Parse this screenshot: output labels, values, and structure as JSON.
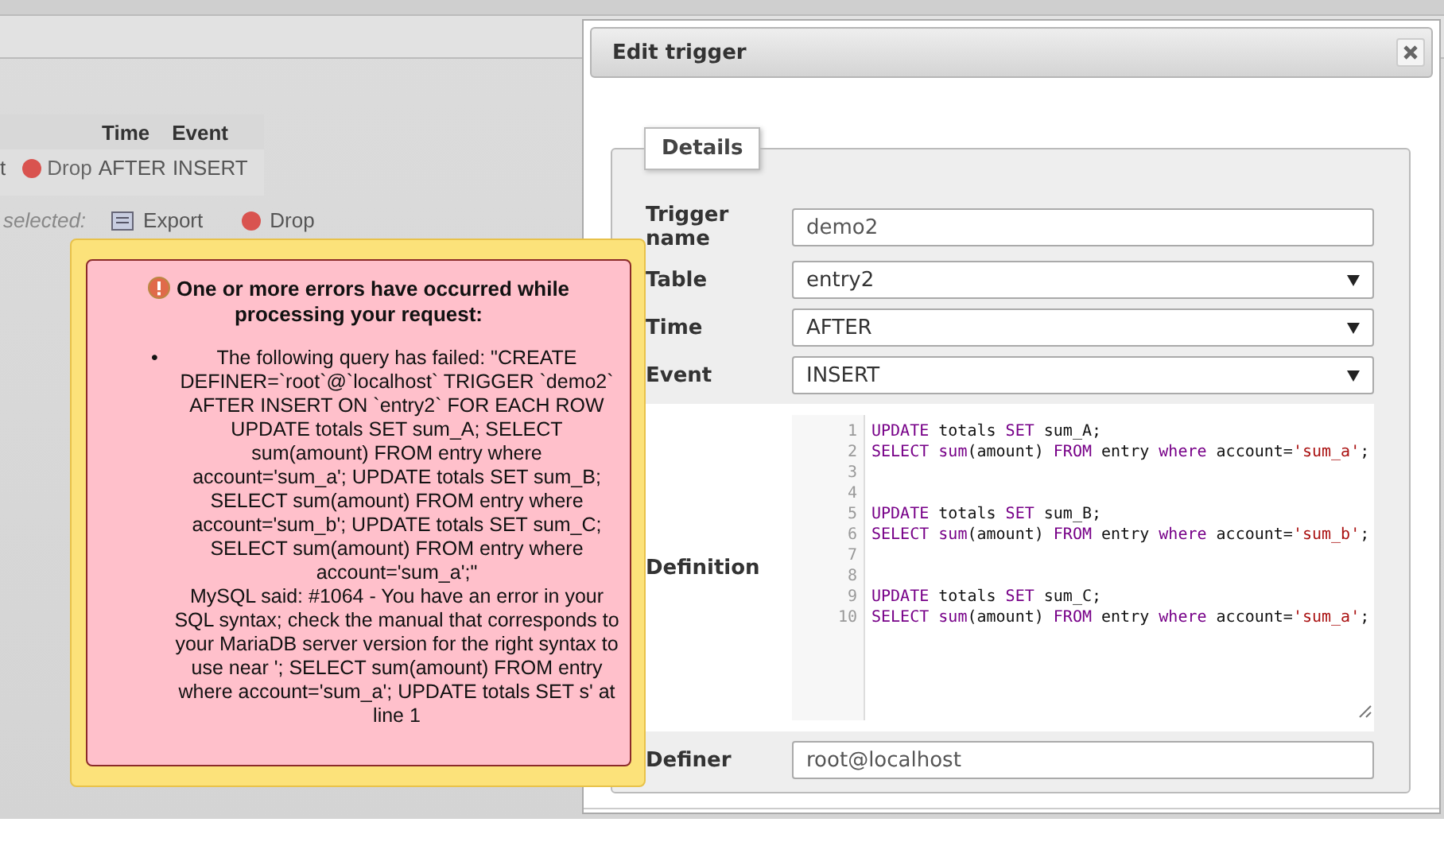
{
  "background_table": {
    "columns": [
      "Time",
      "Event"
    ],
    "row": {
      "action_fragment": "t",
      "drop_label": "Drop",
      "time": "AFTER",
      "event": "INSERT"
    },
    "selection_bar": {
      "label": "selected:",
      "actions": [
        "Export",
        "Drop"
      ]
    }
  },
  "dialog": {
    "title": "Edit trigger",
    "legend": "Details",
    "fields": [
      {
        "kind": "text",
        "label": "Trigger name",
        "value": "demo2"
      },
      {
        "kind": "select",
        "label": "Table",
        "value": "entry2"
      },
      {
        "kind": "select",
        "label": "Time",
        "value": "AFTER"
      },
      {
        "kind": "select",
        "label": "Event",
        "value": "INSERT"
      },
      {
        "kind": "code",
        "label": "Definition",
        "lines": [
          {
            "number": "1",
            "tokens": [
              {
                "kind": "keyword",
                "text": "UPDATE"
              },
              {
                "kind": "plain",
                "text": " totals "
              },
              {
                "kind": "keyword",
                "text": "SET"
              },
              {
                "kind": "plain",
                "text": " sum_A;"
              }
            ]
          },
          {
            "number": "2",
            "tokens": [
              {
                "kind": "keyword",
                "text": "SELECT "
              },
              {
                "kind": "keyword",
                "text": "sum"
              },
              {
                "kind": "plain",
                "text": "(amount) "
              },
              {
                "kind": "keyword",
                "text": "FROM"
              },
              {
                "kind": "plain",
                "text": " entry "
              },
              {
                "kind": "keyword",
                "text": "where"
              },
              {
                "kind": "plain",
                "text": " account="
              },
              {
                "kind": "string",
                "text": "'sum_a'"
              },
              {
                "kind": "plain",
                "text": ";"
              }
            ]
          },
          {
            "number": "3"
          },
          {
            "number": "4"
          },
          {
            "number": "5",
            "tokens": [
              {
                "kind": "keyword",
                "text": "UPDATE"
              },
              {
                "kind": "plain",
                "text": " totals "
              },
              {
                "kind": "keyword",
                "text": "SET"
              },
              {
                "kind": "plain",
                "text": " sum_B;"
              }
            ]
          },
          {
            "number": "6",
            "tokens": [
              {
                "kind": "keyword",
                "text": "SELECT "
              },
              {
                "kind": "keyword",
                "text": "sum"
              },
              {
                "kind": "plain",
                "text": "(amount) "
              },
              {
                "kind": "keyword",
                "text": "FROM"
              },
              {
                "kind": "plain",
                "text": " entry "
              },
              {
                "kind": "keyword",
                "text": "where"
              },
              {
                "kind": "plain",
                "text": " account="
              },
              {
                "kind": "string",
                "text": "'sum_b'"
              },
              {
                "kind": "plain",
                "text": ";"
              }
            ]
          },
          {
            "number": "7"
          },
          {
            "number": "8"
          },
          {
            "number": "9",
            "tokens": [
              {
                "kind": "keyword",
                "text": "UPDATE"
              },
              {
                "kind": "plain",
                "text": " totals "
              },
              {
                "kind": "keyword",
                "text": "SET"
              },
              {
                "kind": "plain",
                "text": " sum_C;"
              }
            ]
          },
          {
            "number": "10",
            "tokens": [
              {
                "kind": "keyword",
                "text": "SELECT "
              },
              {
                "kind": "keyword",
                "text": "sum"
              },
              {
                "kind": "plain",
                "text": "(amount) "
              },
              {
                "kind": "keyword",
                "text": "FROM"
              },
              {
                "kind": "plain",
                "text": " entry "
              },
              {
                "kind": "keyword",
                "text": "where"
              },
              {
                "kind": "plain",
                "text": " account="
              },
              {
                "kind": "string",
                "text": "'sum_a'"
              },
              {
                "kind": "plain",
                "text": ";"
              }
            ]
          }
        ]
      },
      {
        "kind": "text",
        "label": "Definer",
        "value": "root@localhost"
      }
    ]
  },
  "error_popup": {
    "bullet": "•",
    "heading": "One or more errors have occurred while processing your request:",
    "messages": [
      "The following query has failed: \"CREATE DEFINER=`root`@`localhost` TRIGGER `demo2` AFTER INSERT ON `entry2` FOR EACH ROW UPDATE totals SET sum_A; SELECT sum(amount) FROM entry where account='sum_a'; UPDATE totals SET sum_B; SELECT sum(amount) FROM entry where account='sum_b'; UPDATE totals SET sum_C; SELECT sum(amount) FROM entry where account='sum_a';\"",
      "MySQL said: #1064 - You have an error in your SQL syntax; check the manual that corresponds to your MariaDB server version for the right syntax to use near '; SELECT sum(amount) FROM entry where account='sum_a'; UPDATE totals SET s' at line 1"
    ]
  }
}
